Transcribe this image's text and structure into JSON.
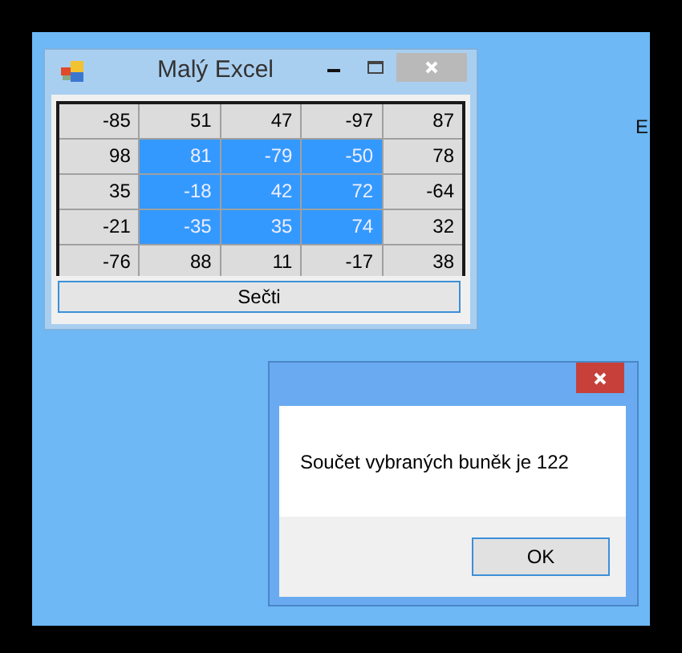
{
  "main_window": {
    "title": "Malý Excel",
    "grid": [
      [
        {
          "text": "-85",
          "selected": false
        },
        {
          "text": "51",
          "selected": false
        },
        {
          "text": "47",
          "selected": false
        },
        {
          "text": "-97",
          "selected": false
        },
        {
          "text": "87",
          "selected": false
        }
      ],
      [
        {
          "text": "98",
          "selected": false
        },
        {
          "text": "81",
          "selected": true
        },
        {
          "text": "-79",
          "selected": true
        },
        {
          "text": "-50",
          "selected": true
        },
        {
          "text": "78",
          "selected": false
        }
      ],
      [
        {
          "text": "35",
          "selected": false
        },
        {
          "text": "-18",
          "selected": true
        },
        {
          "text": "42",
          "selected": true
        },
        {
          "text": "72",
          "selected": true
        },
        {
          "text": "-64",
          "selected": false
        }
      ],
      [
        {
          "text": "-21",
          "selected": false
        },
        {
          "text": "-35",
          "selected": true
        },
        {
          "text": "35",
          "selected": true
        },
        {
          "text": "74",
          "selected": true
        },
        {
          "text": "32",
          "selected": false
        }
      ],
      [
        {
          "text": "-76",
          "selected": false
        },
        {
          "text": "88",
          "selected": false
        },
        {
          "text": "11",
          "selected": false
        },
        {
          "text": "-17",
          "selected": false
        },
        {
          "text": "38",
          "selected": false
        }
      ]
    ],
    "button": "Sečti"
  },
  "dialog": {
    "message": "Součet vybraných buněk je 122",
    "button": "OK"
  },
  "desktop_text": "E"
}
